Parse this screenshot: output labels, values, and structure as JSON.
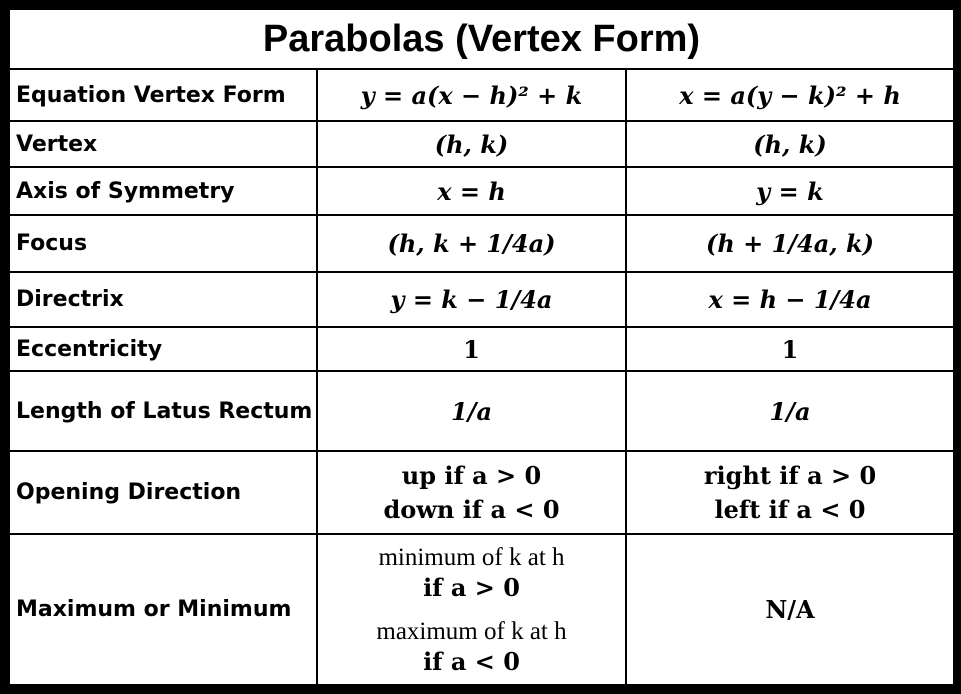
{
  "title": "Parabolas (Vertex Form)",
  "rows": [
    {
      "label": "Equation Vertex Form",
      "col1": "y = a(x − h)² + k",
      "col2": "x = a(y − k)² + h"
    },
    {
      "label": "Vertex",
      "col1": "(h, k)",
      "col2": "(h, k)"
    },
    {
      "label": "Axis of Symmetry",
      "col1": "x = h",
      "col2": "y = k"
    },
    {
      "label": "Focus",
      "col1": "(h, k + 1/4a)",
      "col2": "(h + 1/4a, k)"
    },
    {
      "label": "Directrix",
      "col1": "y = k − 1/4a",
      "col2": "x = h − 1/4a"
    },
    {
      "label": "Eccentricity",
      "col1": "1",
      "col2": "1"
    },
    {
      "label": "Length of Latus Rectum",
      "col1": "1/a",
      "col2": "1/a"
    },
    {
      "label": "Opening Direction",
      "col1_line1": "up if a > 0",
      "col1_line2": "down if a < 0",
      "col2_line1": "right if a > 0",
      "col2_line2": "left if a < 0"
    },
    {
      "label": "Maximum or Minimum",
      "col1_line1": "minimum of k at h",
      "col1_line2": "if a > 0",
      "col1_line3": "maximum of k at h",
      "col1_line4": "if a < 0",
      "col2": "N/A"
    }
  ]
}
